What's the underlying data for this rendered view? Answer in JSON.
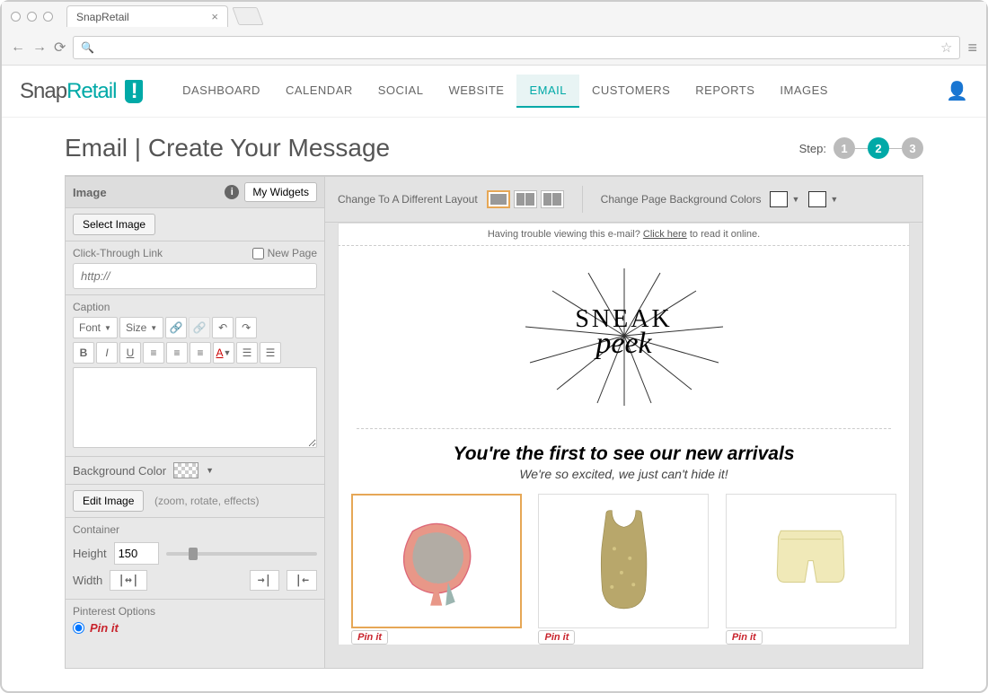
{
  "browser": {
    "tab_title": "SnapRetail"
  },
  "logo": {
    "part1": "Snap",
    "part2": "Retail",
    "badge": "!"
  },
  "nav": {
    "items": [
      "DASHBOARD",
      "CALENDAR",
      "SOCIAL",
      "WEBSITE",
      "EMAIL",
      "CUSTOMERS",
      "REPORTS",
      "IMAGES"
    ],
    "active_index": 4
  },
  "page_title": "Email | Create Your Message",
  "steps": {
    "label": "Step:",
    "items": [
      "1",
      "2",
      "3"
    ],
    "active_index": 1
  },
  "sidebar": {
    "header_title": "Image",
    "my_widgets": "My Widgets",
    "select_image": "Select Image",
    "click_through_label": "Click-Through Link",
    "new_page": "New Page",
    "url_placeholder": "http://",
    "caption_label": "Caption",
    "font_label": "Font",
    "size_label": "Size",
    "bg_color_label": "Background Color",
    "edit_image": "Edit Image",
    "edit_hint": "(zoom, rotate, effects)",
    "container_label": "Container",
    "height_label": "Height",
    "height_value": "150",
    "width_label": "Width",
    "pinterest_label": "Pinterest Options",
    "pin_it": "Pin it"
  },
  "canvas": {
    "layout_label": "Change To A Different Layout",
    "bg_label": "Change Page Background Colors",
    "trouble_prefix": "Having trouble viewing this e-mail? ",
    "trouble_link": "Click here",
    "trouble_suffix": " to read it online.",
    "sneak": "SNEAK",
    "peek": "peek",
    "headline": "You're the first to see our new arrivals",
    "subhead": "We're so excited, we just can't hide it!",
    "pin_it": "Pin it"
  }
}
